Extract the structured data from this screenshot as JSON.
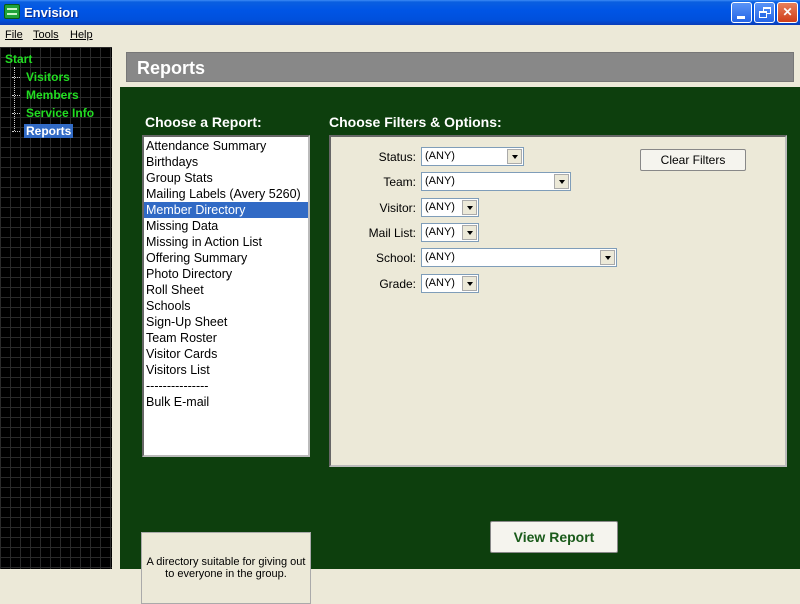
{
  "window": {
    "title": "Envision"
  },
  "titlebar_buttons": {
    "minimize": "",
    "maximize": "",
    "close": "✕"
  },
  "menu": [
    {
      "label": "File"
    },
    {
      "label": "Tools"
    },
    {
      "label": "Help"
    }
  ],
  "nav": {
    "root": "Start",
    "items": [
      {
        "label": "Visitors",
        "selected": false
      },
      {
        "label": "Members",
        "selected": false
      },
      {
        "label": "Service Info",
        "selected": false
      },
      {
        "label": "Reports",
        "selected": true
      }
    ]
  },
  "page": {
    "title": "Reports"
  },
  "reports": {
    "heading": "Choose a Report:",
    "items": [
      "Attendance Summary",
      "Birthdays",
      "Group Stats",
      "Mailing Labels (Avery 5260)",
      "Member Directory",
      "Missing Data",
      "Missing in Action List",
      "Offering Summary",
      "Photo Directory",
      "Roll Sheet",
      "Schools",
      "Sign-Up Sheet",
      "Team Roster",
      "Visitor Cards",
      "Visitors List",
      "---------------",
      "Bulk E-mail"
    ],
    "selected_index": 4
  },
  "filters": {
    "heading": "Choose Filters & Options:",
    "fields": [
      {
        "label": "Status:",
        "value": "(ANY)"
      },
      {
        "label": "Team:",
        "value": "(ANY)"
      },
      {
        "label": "Visitor:",
        "value": "(ANY)"
      },
      {
        "label": "Mail List:",
        "value": "(ANY)"
      },
      {
        "label": "School:",
        "value": "(ANY)"
      },
      {
        "label": "Grade:",
        "value": "(ANY)"
      }
    ],
    "clear_label": "Clear Filters"
  },
  "actions": {
    "view_report_label": "View Report"
  },
  "description": "A directory suitable for giving out to everyone in the group.",
  "colors": {
    "nav_green": "#22dd22",
    "panel_green": "#0d3f0d",
    "selection": "#316ac5",
    "header_gray": "#888888"
  }
}
